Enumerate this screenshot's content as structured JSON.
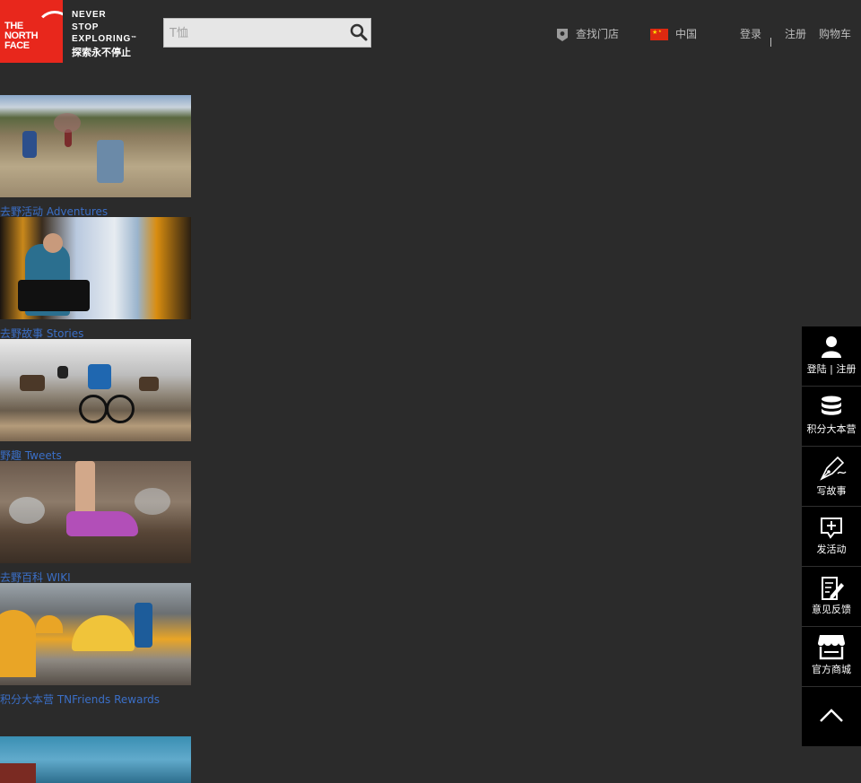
{
  "header": {
    "logo_text": "THE\nNORTH\nFACE",
    "slogan_en": "NEVER\nSTOP\nEXPLORING",
    "slogan_tm": "™",
    "slogan_cn": "探索永不停止",
    "search_placeholder": "T恤",
    "store_locator": "查找门店",
    "country": "中国",
    "login": "登录",
    "register": "注册",
    "cart": "购物车"
  },
  "tiles": [
    {
      "caption": "去野活动 Adventures"
    },
    {
      "caption": "去野故事 Stories"
    },
    {
      "caption": "野趣 Tweets"
    },
    {
      "caption": "去野百科 WIKI"
    },
    {
      "caption": "积分大本营 TNFriends Rewards"
    }
  ],
  "sidebar": {
    "items": [
      {
        "label": "登陆 | 注册",
        "icon": "user-icon"
      },
      {
        "label": "积分大本营",
        "icon": "coins-icon"
      },
      {
        "label": "写故事",
        "icon": "pen-icon"
      },
      {
        "label": "发活动",
        "icon": "add-message-icon"
      },
      {
        "label": "意见反馈",
        "icon": "feedback-icon"
      },
      {
        "label": "官方商城",
        "icon": "store-icon"
      }
    ],
    "back_to_top_icon": "chevron-up-icon"
  },
  "colors": {
    "background": "#2b2b2b",
    "brand_red": "#e8271c",
    "link_blue": "#3b6fc7",
    "sidebar_bg": "#000000"
  }
}
